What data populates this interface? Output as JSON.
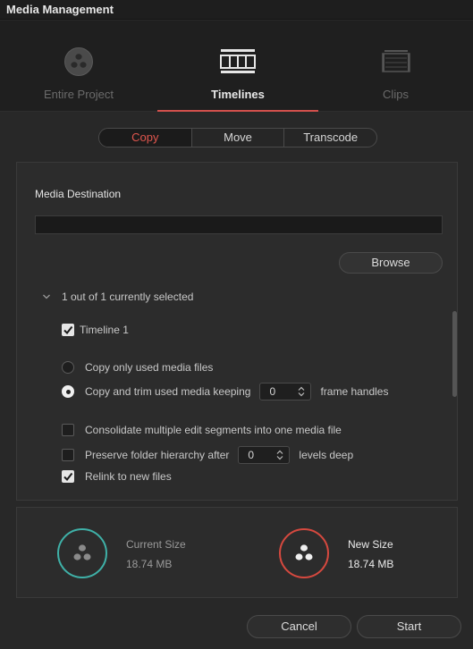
{
  "window": {
    "title": "Media Management"
  },
  "nav": {
    "tabs": [
      {
        "label": "Entire Project",
        "icon": "resolve-logo-icon",
        "active": false
      },
      {
        "label": "Timelines",
        "icon": "timeline-icon",
        "active": true
      },
      {
        "label": "Clips",
        "icon": "clips-icon",
        "active": false
      }
    ]
  },
  "mode": {
    "options": [
      "Copy",
      "Move",
      "Transcode"
    ],
    "selected": "Copy"
  },
  "destination": {
    "title": "Media Destination",
    "value": "",
    "browse_label": "Browse"
  },
  "selection": {
    "summary": "1 out of 1 currently selected",
    "items": [
      {
        "label": "Timeline 1",
        "checked": true
      }
    ]
  },
  "options": {
    "copy_used": "Copy only used media files",
    "copy_trim": "Copy and trim used media keeping",
    "handles_value": "0",
    "handles_suffix": "frame handles",
    "consolidate": "Consolidate multiple edit segments into one media file",
    "preserve": "Preserve folder hierarchy after",
    "levels_value": "0",
    "levels_suffix": "levels deep",
    "relink": "Relink to new files",
    "selected_radio": "copy_trim",
    "consolidate_checked": false,
    "preserve_checked": false,
    "relink_checked": true
  },
  "sizes": {
    "current_label": "Current Size",
    "current_value": "18.74 MB",
    "new_label": "New Size",
    "new_value": "18.74 MB",
    "current_color": "#3fb1a8",
    "new_color": "#d6493f"
  },
  "footer": {
    "cancel_label": "Cancel",
    "start_label": "Start"
  },
  "colors": {
    "accent": "#d2504c",
    "background": "#282828"
  }
}
